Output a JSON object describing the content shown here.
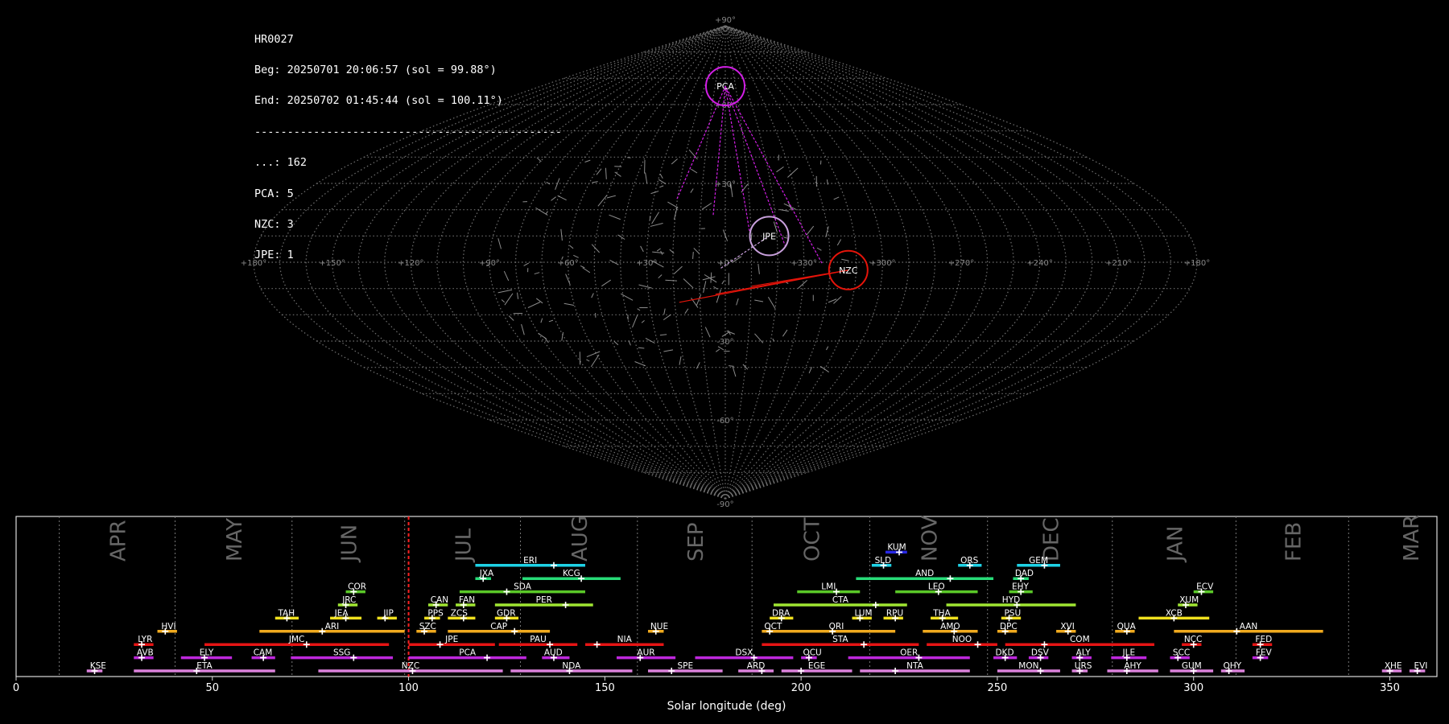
{
  "info": {
    "station": "HR0027",
    "begin": "Beg: 20250701 20:06:57 (sol = 99.88°)",
    "end": "End: 20250702 01:45:44 (sol = 100.11°)",
    "separator": "-----------------------------------------------",
    "counts": [
      {
        "label": "...:",
        "value": "162"
      },
      {
        "label": "PCA:",
        "value": "5"
      },
      {
        "label": "NZC:",
        "value": "3"
      },
      {
        "label": "JPE:",
        "value": "1"
      }
    ]
  },
  "colors": {
    "background": "#000000",
    "grid": "#8c8c8c",
    "PCA": "#d21ee6",
    "NZC": "#e6140a",
    "JPE": "#c8a0dc",
    "sporadic": "#bbbbbb"
  },
  "chart_data": [
    {
      "type": "scatter",
      "projection": "sinusoidal",
      "lon_labels": [
        "+180°",
        "+150°",
        "+120°",
        "+90°",
        "+60°",
        "+30°",
        "+0°",
        "+330°",
        "+300°",
        "+270°",
        "+240°",
        "+210°",
        "+180°"
      ],
      "lat_labels": [
        "+90°",
        "+60°",
        "+30°",
        "+0°",
        "-30°",
        "-60°",
        "-90°"
      ],
      "grid": true,
      "radiants": [
        {
          "code": "PCA",
          "lon": 0,
          "lat": 67
        },
        {
          "code": "JPE",
          "lon": 343,
          "lat": 10
        },
        {
          "code": "NZC",
          "lon": 313,
          "lat": -3
        }
      ],
      "sporadic_count": 162
    },
    {
      "type": "bar",
      "orientation": "horizontal",
      "xlabel": "Solar longitude (deg)",
      "xlim": [
        0,
        362
      ],
      "xticks": [
        0,
        50,
        100,
        150,
        200,
        250,
        300,
        350
      ],
      "current_sol": 100,
      "months": [
        {
          "name": "APR",
          "start": 11
        },
        {
          "name": "MAY",
          "start": 40.5
        },
        {
          "name": "JUN",
          "start": 70.3
        },
        {
          "name": "JUL",
          "start": 99
        },
        {
          "name": "AUG",
          "start": 128.5
        },
        {
          "name": "SEP",
          "start": 158.3
        },
        {
          "name": "OCT",
          "start": 187.5
        },
        {
          "name": "NOV",
          "start": 217.5
        },
        {
          "name": "DEC",
          "start": 247.5
        },
        {
          "name": "JAN",
          "start": 279.3
        },
        {
          "name": "FEB",
          "start": 310.8
        },
        {
          "name": "MAR",
          "start": 339.5
        }
      ],
      "showers": [
        {
          "code": "KUM",
          "start": 221.5,
          "end": 227,
          "peak": 225,
          "row": 10,
          "color": "#2828e6"
        },
        {
          "code": "ERI",
          "start": 117,
          "end": 145,
          "peak": 137,
          "row": 9,
          "color": "#1ed2e6"
        },
        {
          "code": "SLD",
          "start": 218,
          "end": 223,
          "peak": 221,
          "row": 9,
          "color": "#1ed2e6"
        },
        {
          "code": "ORS",
          "start": 240,
          "end": 246,
          "peak": 243,
          "row": 9,
          "color": "#1ed2e6"
        },
        {
          "code": "GEM",
          "start": 255,
          "end": 266,
          "peak": 262,
          "row": 9,
          "color": "#1ed2e6"
        },
        {
          "code": "JXA",
          "start": 117,
          "end": 121,
          "peak": 119,
          "row": 8,
          "color": "#28dc78"
        },
        {
          "code": "KCG",
          "start": 129,
          "end": 154,
          "peak": 144,
          "row": 8,
          "color": "#28dc78"
        },
        {
          "code": "AND",
          "start": 214,
          "end": 249,
          "peak": 238,
          "row": 8,
          "color": "#28dc78"
        },
        {
          "code": "DAD",
          "start": 254,
          "end": 258,
          "peak": 256,
          "row": 8,
          "color": "#28dc78"
        },
        {
          "code": "COR",
          "start": 84,
          "end": 89,
          "peak": 86,
          "row": 7,
          "color": "#5ac828"
        },
        {
          "code": "SDA",
          "start": 113,
          "end": 145,
          "peak": 125,
          "row": 7,
          "color": "#5ac828"
        },
        {
          "code": "LMI",
          "start": 199,
          "end": 215,
          "peak": 209,
          "row": 7,
          "color": "#5ac828"
        },
        {
          "code": "LEO",
          "start": 224,
          "end": 245,
          "peak": 235,
          "row": 7,
          "color": "#5ac828"
        },
        {
          "code": "EHY",
          "start": 253,
          "end": 259,
          "peak": 256,
          "row": 7,
          "color": "#5ac828"
        },
        {
          "code": "ECV",
          "start": 300,
          "end": 305,
          "peak": 302,
          "row": 7,
          "color": "#5ac828"
        },
        {
          "code": "JRC",
          "start": 82,
          "end": 87,
          "peak": 84,
          "row": 6,
          "color": "#a0e632"
        },
        {
          "code": "CAN",
          "start": 105,
          "end": 110,
          "peak": 107,
          "row": 6,
          "color": "#a0e632"
        },
        {
          "code": "FAN",
          "start": 112,
          "end": 117,
          "peak": 114,
          "row": 6,
          "color": "#a0e632"
        },
        {
          "code": "PER",
          "start": 122,
          "end": 147,
          "peak": 140,
          "row": 6,
          "color": "#a0e632"
        },
        {
          "code": "CTA",
          "start": 193,
          "end": 227,
          "peak": 219,
          "row": 6,
          "color": "#a0e632"
        },
        {
          "code": "HYD",
          "start": 237,
          "end": 270,
          "peak": 255,
          "row": 6,
          "color": "#a0e632"
        },
        {
          "code": "XUM",
          "start": 296,
          "end": 301,
          "peak": 298,
          "row": 6,
          "color": "#a0e632"
        },
        {
          "code": "TAH",
          "start": 66,
          "end": 72,
          "peak": 69,
          "row": 5,
          "color": "#f0e11e"
        },
        {
          "code": "JEA",
          "start": 80,
          "end": 88,
          "peak": 84,
          "row": 5,
          "color": "#f0e11e"
        },
        {
          "code": "JIP",
          "start": 92,
          "end": 97,
          "peak": 94,
          "row": 5,
          "color": "#f0e11e"
        },
        {
          "code": "PPS",
          "start": 104,
          "end": 108,
          "peak": 106,
          "row": 5,
          "color": "#f0e11e"
        },
        {
          "code": "ZCS",
          "start": 110,
          "end": 117,
          "peak": 114,
          "row": 5,
          "color": "#f0e11e"
        },
        {
          "code": "GDR",
          "start": 122,
          "end": 128,
          "peak": 125,
          "row": 5,
          "color": "#f0e11e"
        },
        {
          "code": "DRA",
          "start": 192,
          "end": 198,
          "peak": 195,
          "row": 5,
          "color": "#f0e11e"
        },
        {
          "code": "LUM",
          "start": 213,
          "end": 218,
          "peak": 215,
          "row": 5,
          "color": "#f0e11e"
        },
        {
          "code": "RPU",
          "start": 221,
          "end": 226,
          "peak": 224,
          "row": 5,
          "color": "#f0e11e"
        },
        {
          "code": "THA",
          "start": 233,
          "end": 240,
          "peak": 236,
          "row": 5,
          "color": "#f0e11e"
        },
        {
          "code": "PSU",
          "start": 251,
          "end": 256,
          "peak": 253,
          "row": 5,
          "color": "#f0e11e"
        },
        {
          "code": "XCB",
          "start": 286,
          "end": 304,
          "peak": 295,
          "row": 5,
          "color": "#f0e11e"
        },
        {
          "code": "HVI",
          "start": 36,
          "end": 41,
          "peak": 38,
          "row": 4,
          "color": "#f0aa1e"
        },
        {
          "code": "ARI",
          "start": 62,
          "end": 99,
          "peak": 78,
          "row": 4,
          "color": "#f0aa1e"
        },
        {
          "code": "SZC",
          "start": 102,
          "end": 107,
          "peak": 104,
          "row": 4,
          "color": "#f0aa1e"
        },
        {
          "code": "CAP",
          "start": 110,
          "end": 136,
          "peak": 127,
          "row": 4,
          "color": "#f0aa1e"
        },
        {
          "code": "NUE",
          "start": 161,
          "end": 165,
          "peak": 163,
          "row": 4,
          "color": "#f0aa1e"
        },
        {
          "code": "OCT",
          "start": 190,
          "end": 195,
          "peak": 192,
          "row": 4,
          "color": "#f0aa1e"
        },
        {
          "code": "ORI",
          "start": 194,
          "end": 224,
          "peak": 208,
          "row": 4,
          "color": "#f0aa1e"
        },
        {
          "code": "AMO",
          "start": 231,
          "end": 245,
          "peak": 239,
          "row": 4,
          "color": "#f0aa1e"
        },
        {
          "code": "DPC",
          "start": 250,
          "end": 255,
          "peak": 252,
          "row": 4,
          "color": "#f0aa1e"
        },
        {
          "code": "XVI",
          "start": 265,
          "end": 270,
          "peak": 268,
          "row": 4,
          "color": "#f0aa1e"
        },
        {
          "code": "QUA",
          "start": 280,
          "end": 285,
          "peak": 283,
          "row": 4,
          "color": "#f0aa1e"
        },
        {
          "code": "AAN",
          "start": 295,
          "end": 333,
          "peak": 311,
          "row": 4,
          "color": "#f0aa1e"
        },
        {
          "code": "LYR",
          "start": 30,
          "end": 35,
          "peak": 32,
          "row": 3,
          "color": "#e61414"
        },
        {
          "code": "JMC",
          "start": 48,
          "end": 95,
          "peak": 74,
          "row": 3,
          "color": "#e61414"
        },
        {
          "code": "JPE",
          "start": 100,
          "end": 122,
          "peak": 108,
          "row": 3,
          "color": "#e61414"
        },
        {
          "code": "PAU",
          "start": 123,
          "end": 143,
          "peak": 136,
          "row": 3,
          "color": "#e61414"
        },
        {
          "code": "NIA",
          "start": 145,
          "end": 165,
          "peak": 148,
          "row": 3,
          "color": "#e61414"
        },
        {
          "code": "STA",
          "start": 190,
          "end": 230,
          "peak": 216,
          "row": 3,
          "color": "#e61414"
        },
        {
          "code": "NOO",
          "start": 232,
          "end": 250,
          "peak": 245,
          "row": 3,
          "color": "#e61414"
        },
        {
          "code": "COM",
          "start": 252,
          "end": 290,
          "peak": 262,
          "row": 3,
          "color": "#e61414"
        },
        {
          "code": "NCC",
          "start": 297,
          "end": 302,
          "peak": 300,
          "row": 3,
          "color": "#e61414"
        },
        {
          "code": "FED",
          "start": 315,
          "end": 320,
          "peak": 317,
          "row": 3,
          "color": "#e61414"
        },
        {
          "code": "AVB",
          "start": 30,
          "end": 35,
          "peak": 32,
          "row": 2,
          "color": "#be28dc"
        },
        {
          "code": "ELY",
          "start": 42,
          "end": 55,
          "peak": 48,
          "row": 2,
          "color": "#be28dc"
        },
        {
          "code": "CAM",
          "start": 60,
          "end": 66,
          "peak": 63,
          "row": 2,
          "color": "#be28dc"
        },
        {
          "code": "SSG",
          "start": 70,
          "end": 96,
          "peak": 86,
          "row": 2,
          "color": "#be28dc"
        },
        {
          "code": "PCA",
          "start": 100,
          "end": 130,
          "peak": 120,
          "row": 2,
          "color": "#be28dc"
        },
        {
          "code": "AUD",
          "start": 134,
          "end": 141,
          "peak": 137,
          "row": 2,
          "color": "#be28dc"
        },
        {
          "code": "AUR",
          "start": 153,
          "end": 168,
          "peak": 159,
          "row": 2,
          "color": "#be28dc"
        },
        {
          "code": "DSX",
          "start": 173,
          "end": 198,
          "peak": 188,
          "row": 2,
          "color": "#be28dc"
        },
        {
          "code": "OCU",
          "start": 200,
          "end": 204,
          "peak": 202,
          "row": 2,
          "color": "#be28dc"
        },
        {
          "code": "OER",
          "start": 212,
          "end": 243,
          "peak": 230,
          "row": 2,
          "color": "#be28dc"
        },
        {
          "code": "DKD",
          "start": 249,
          "end": 255,
          "peak": 252,
          "row": 2,
          "color": "#be28dc"
        },
        {
          "code": "DSV",
          "start": 258,
          "end": 263,
          "peak": 261,
          "row": 2,
          "color": "#be28dc"
        },
        {
          "code": "ALY",
          "start": 269,
          "end": 274,
          "peak": 271,
          "row": 2,
          "color": "#be28dc"
        },
        {
          "code": "JLE",
          "start": 279,
          "end": 288,
          "peak": 283,
          "row": 2,
          "color": "#be28dc"
        },
        {
          "code": "SCC",
          "start": 294,
          "end": 299,
          "peak": 296,
          "row": 2,
          "color": "#be28dc"
        },
        {
          "code": "FEV",
          "start": 315,
          "end": 319,
          "peak": 317,
          "row": 2,
          "color": "#be28dc"
        },
        {
          "code": "KSE",
          "start": 18,
          "end": 22,
          "peak": 20,
          "row": 1,
          "color": "#dc82dc"
        },
        {
          "code": "ETA",
          "start": 30,
          "end": 66,
          "peak": 46,
          "row": 1,
          "color": "#dc82dc"
        },
        {
          "code": "NZC",
          "start": 77,
          "end": 124,
          "peak": 101,
          "row": 1,
          "color": "#dc82dc"
        },
        {
          "code": "NDA",
          "start": 126,
          "end": 157,
          "peak": 141,
          "row": 1,
          "color": "#dc82dc"
        },
        {
          "code": "SPE",
          "start": 161,
          "end": 180,
          "peak": 167,
          "row": 1,
          "color": "#dc82dc"
        },
        {
          "code": "ARD",
          "start": 184,
          "end": 193,
          "peak": 190,
          "row": 1,
          "color": "#dc82dc"
        },
        {
          "code": "EGE",
          "start": 195,
          "end": 213,
          "peak": 200,
          "row": 1,
          "color": "#dc82dc"
        },
        {
          "code": "NTA",
          "start": 215,
          "end": 243,
          "peak": 224,
          "row": 1,
          "color": "#dc82dc"
        },
        {
          "code": "MON",
          "start": 250,
          "end": 266,
          "peak": 261,
          "row": 1,
          "color": "#dc82dc"
        },
        {
          "code": "URS",
          "start": 269,
          "end": 273,
          "peak": 271,
          "row": 1,
          "color": "#dc82dc"
        },
        {
          "code": "AHY",
          "start": 278,
          "end": 291,
          "peak": 283,
          "row": 1,
          "color": "#dc82dc"
        },
        {
          "code": "GUM",
          "start": 294,
          "end": 305,
          "peak": 300,
          "row": 1,
          "color": "#dc82dc"
        },
        {
          "code": "OHY",
          "start": 307,
          "end": 313,
          "peak": 309,
          "row": 1,
          "color": "#dc82dc"
        },
        {
          "code": "XHE",
          "start": 348,
          "end": 353,
          "peak": 350,
          "row": 1,
          "color": "#dc82dc"
        },
        {
          "code": "EVI",
          "start": 355,
          "end": 359,
          "peak": 357,
          "row": 1,
          "color": "#dc82dc"
        }
      ]
    }
  ]
}
